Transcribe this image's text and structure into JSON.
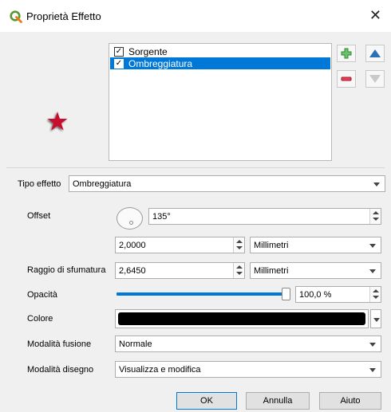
{
  "window": {
    "title": "Proprietà Effetto"
  },
  "effects": {
    "items": [
      {
        "label": "Sorgente",
        "checked": true,
        "selected": false
      },
      {
        "label": "Ombreggiatura",
        "checked": true,
        "selected": true
      }
    ]
  },
  "icons": {
    "app": "qgis-logo-icon",
    "close": "close-icon",
    "add": "plus-icon",
    "remove": "minus-icon",
    "up": "arrow-up-icon",
    "down": "arrow-down-icon",
    "preview": "star-icon"
  },
  "colors": {
    "accent": "#0078d7",
    "star": "#c8102e",
    "add_green": "#3aa03a",
    "remove_red": "#d9304a",
    "shadow_color": "#000000"
  },
  "form": {
    "effect_type": {
      "label": "Tipo effetto",
      "value": "Ombreggiatura"
    },
    "offset": {
      "label": "Offset",
      "angle": "135°",
      "distance": "2,0000",
      "unit": "Millimetri"
    },
    "blur": {
      "label": "Raggio di sfumatura",
      "value": "2,6450",
      "unit": "Millimetri"
    },
    "opacity": {
      "label": "Opacità",
      "value": "100,0 %",
      "fraction": 1.0
    },
    "color": {
      "label": "Colore"
    },
    "blend": {
      "label": "Modalità fusione",
      "value": "Normale"
    },
    "draw_mode": {
      "label": "Modalità disegno",
      "value": "Visualizza e modifica"
    }
  },
  "buttons": {
    "ok": "OK",
    "cancel": "Annulla",
    "help": "Aiuto"
  }
}
